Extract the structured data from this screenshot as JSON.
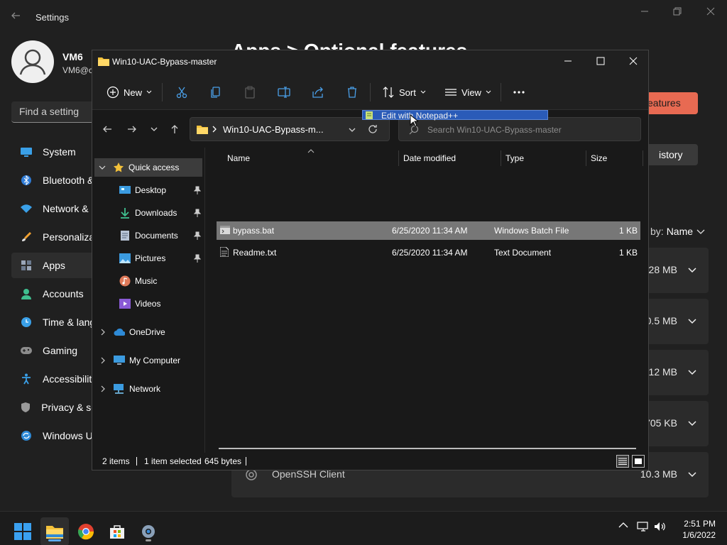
{
  "settings": {
    "title": "Settings",
    "back_icon": "arrow-left-icon",
    "user": {
      "name": "VM6",
      "email": "VM6@c"
    },
    "search_placeholder": "Find a setting",
    "page_heading": "Apps > Optional features",
    "nav": [
      {
        "label": "System",
        "icon": "monitor-icon"
      },
      {
        "label": "Bluetooth &",
        "icon": "bluetooth-icon"
      },
      {
        "label": "Network &",
        "icon": "wifi-icon"
      },
      {
        "label": "Personaliza",
        "icon": "brush-icon"
      },
      {
        "label": "Apps",
        "icon": "apps-icon",
        "active": true
      },
      {
        "label": "Accounts",
        "icon": "person-icon"
      },
      {
        "label": "Time & lang",
        "icon": "clock-icon"
      },
      {
        "label": "Gaming",
        "icon": "gamepad-icon"
      },
      {
        "label": "Accessibilit",
        "icon": "accessibility-icon"
      },
      {
        "label": "Privacy & se",
        "icon": "shield-icon"
      },
      {
        "label": "Windows U",
        "icon": "update-icon"
      }
    ],
    "add_features_label": "eatures",
    "history_label": "istory",
    "sort_label": "by:",
    "sort_value": "Name",
    "features": [
      {
        "name": "",
        "size": "28 MB"
      },
      {
        "name": "",
        "size": "0.5 MB"
      },
      {
        "name": "",
        "size": ".12 MB"
      },
      {
        "name": "",
        "size": "705 KB"
      },
      {
        "name": "OpenSSH Client",
        "size": "10.3 MB"
      }
    ]
  },
  "explorer": {
    "title": "Win10-UAC-Bypass-master",
    "toolbar": {
      "new_label": "New",
      "sort_label": "Sort",
      "view_label": "View"
    },
    "address": "Win10-UAC-Bypass-m...",
    "search_placeholder": "Search Win10-UAC-Bypass-master",
    "nav_pane": {
      "quick_access": "Quick access",
      "items": [
        "Desktop",
        "Downloads",
        "Documents",
        "Pictures",
        "Music",
        "Videos"
      ],
      "onedrive": "OneDrive",
      "my_computer": "My Computer",
      "network": "Network"
    },
    "columns": {
      "name": "Name",
      "date": "Date modified",
      "type": "Type",
      "size": "Size"
    },
    "files": [
      {
        "name": "bypass.bat",
        "date": "6/25/2020 11:34 AM",
        "type": "Windows Batch File",
        "size": "1 KB",
        "selected": true
      },
      {
        "name": "Readme.txt",
        "date": "6/25/2020 11:34 AM",
        "type": "Text Document",
        "size": "1 KB",
        "selected": false
      }
    ],
    "status": {
      "count": "2 items",
      "selection": "1 item selected",
      "bytes": "645 bytes"
    },
    "context_item": "Edit with Notepad++"
  },
  "taskbar": {
    "time": "2:51 PM",
    "date": "1/6/2022"
  },
  "colors": {
    "accent": "#e86a52",
    "selection": "#777777",
    "folder": "#f3c13a"
  }
}
